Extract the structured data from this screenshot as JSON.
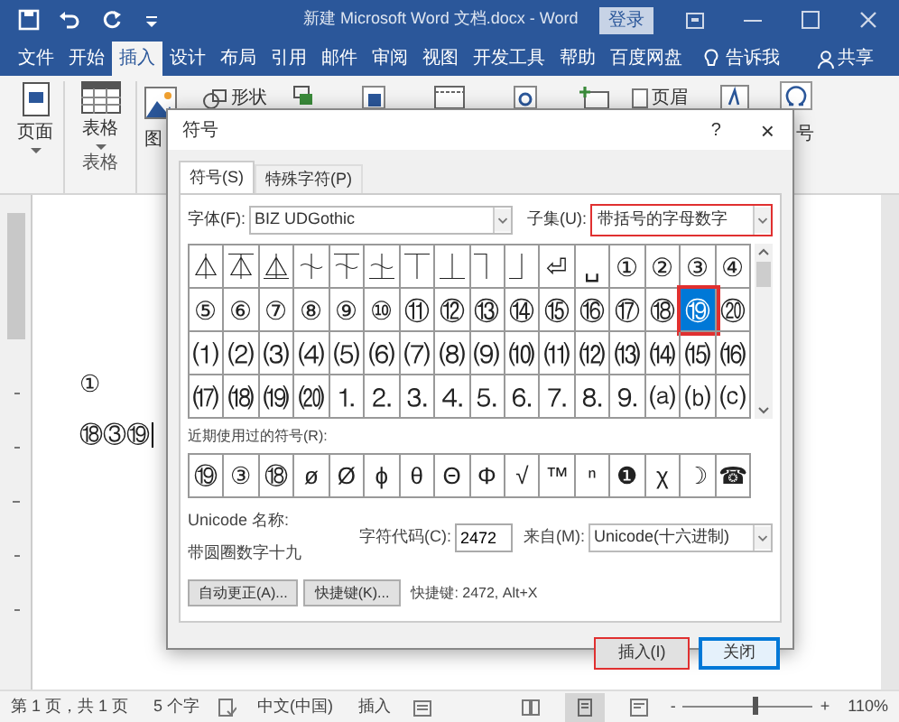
{
  "title_bar": {
    "title": "新建 Microsoft Word 文档.docx - Word",
    "login": "登录"
  },
  "menu_tabs": [
    {
      "label": "文件",
      "selected": false
    },
    {
      "label": "开始",
      "selected": false
    },
    {
      "label": "插入",
      "selected": true
    },
    {
      "label": "设计",
      "selected": false
    },
    {
      "label": "布局",
      "selected": false
    },
    {
      "label": "引用",
      "selected": false
    },
    {
      "label": "邮件",
      "selected": false
    },
    {
      "label": "审阅",
      "selected": false
    },
    {
      "label": "视图",
      "selected": false
    },
    {
      "label": "开发工具",
      "selected": false
    },
    {
      "label": "帮助",
      "selected": false
    },
    {
      "label": "百度网盘",
      "selected": false
    }
  ],
  "tell_me": "告诉我",
  "share": "共享",
  "ribbon": {
    "page_button": "页面",
    "table_button": "表格",
    "table_group": "表格",
    "picture_button": "图",
    "shapes_button": "形状",
    "header_button": "页眉",
    "symbol_button": "号"
  },
  "document": {
    "lines": [
      "①",
      "⑱③⑲"
    ]
  },
  "dialog": {
    "title": "符号",
    "help": "?",
    "close": "×",
    "tabs": [
      {
        "label": "符号(S)",
        "selected": true
      },
      {
        "label": "特殊字符(P)",
        "selected": false
      }
    ],
    "font_label": "字体(F):",
    "font": "BIZ UDGothic",
    "subset_label": "子集(U):",
    "subset": {
      "value": "带括号的字母数字",
      "highlighted": true
    },
    "symbol_rows": [
      [
        {
          "char": "⏃",
          "selected": false
        },
        {
          "char": "⏄",
          "selected": false
        },
        {
          "char": "⏅",
          "selected": false
        },
        {
          "char": "⏆",
          "selected": false
        },
        {
          "char": "⏇",
          "selected": false
        },
        {
          "char": "⏈",
          "selected": false
        },
        {
          "char": "⏉",
          "selected": false
        },
        {
          "char": "⏊",
          "selected": false
        },
        {
          "char": "⏋",
          "selected": false
        },
        {
          "char": "⏌",
          "selected": false
        },
        {
          "char": "⏎",
          "selected": false
        },
        {
          "char": "␣",
          "selected": false
        },
        {
          "char": "①",
          "selected": false
        },
        {
          "char": "②",
          "selected": false
        },
        {
          "char": "③",
          "selected": false
        },
        {
          "char": "④",
          "selected": false
        }
      ],
      [
        {
          "char": "⑤",
          "selected": false
        },
        {
          "char": "⑥",
          "selected": false
        },
        {
          "char": "⑦",
          "selected": false
        },
        {
          "char": "⑧",
          "selected": false
        },
        {
          "char": "⑨",
          "selected": false
        },
        {
          "char": "⑩",
          "selected": false
        },
        {
          "char": "⑪",
          "selected": false
        },
        {
          "char": "⑫",
          "selected": false
        },
        {
          "char": "⑬",
          "selected": false
        },
        {
          "char": "⑭",
          "selected": false
        },
        {
          "char": "⑮",
          "selected": false
        },
        {
          "char": "⑯",
          "selected": false
        },
        {
          "char": "⑰",
          "selected": false
        },
        {
          "char": "⑱",
          "selected": false
        },
        {
          "char": "⑲",
          "selected": true
        },
        {
          "char": "⑳",
          "selected": false
        }
      ],
      [
        {
          "char": "⑴",
          "selected": false
        },
        {
          "char": "⑵",
          "selected": false
        },
        {
          "char": "⑶",
          "selected": false
        },
        {
          "char": "⑷",
          "selected": false
        },
        {
          "char": "⑸",
          "selected": false
        },
        {
          "char": "⑹",
          "selected": false
        },
        {
          "char": "⑺",
          "selected": false
        },
        {
          "char": "⑻",
          "selected": false
        },
        {
          "char": "⑼",
          "selected": false
        },
        {
          "char": "⑽",
          "selected": false
        },
        {
          "char": "⑾",
          "selected": false
        },
        {
          "char": "⑿",
          "selected": false
        },
        {
          "char": "⒀",
          "selected": false
        },
        {
          "char": "⒁",
          "selected": false
        },
        {
          "char": "⒂",
          "selected": false
        },
        {
          "char": "⒃",
          "selected": false
        }
      ],
      [
        {
          "char": "⒄",
          "selected": false
        },
        {
          "char": "⒅",
          "selected": false
        },
        {
          "char": "⒆",
          "selected": false
        },
        {
          "char": "⒇",
          "selected": false
        },
        {
          "char": "⒈",
          "selected": false
        },
        {
          "char": "⒉",
          "selected": false
        },
        {
          "char": "⒊",
          "selected": false
        },
        {
          "char": "⒋",
          "selected": false
        },
        {
          "char": "⒌",
          "selected": false
        },
        {
          "char": "⒍",
          "selected": false
        },
        {
          "char": "⒎",
          "selected": false
        },
        {
          "char": "⒏",
          "selected": false
        },
        {
          "char": "⒐",
          "selected": false
        },
        {
          "char": "⒜",
          "selected": false
        },
        {
          "char": "⒝",
          "selected": false
        },
        {
          "char": "⒞",
          "selected": false
        }
      ]
    ],
    "recent_label": "近期使用过的符号(R):",
    "recent": [
      "⑲",
      "③",
      "⑱",
      "ø",
      "Ø",
      "ϕ",
      "θ",
      "Θ",
      "Φ",
      "√",
      "™",
      "ⁿ",
      "❶",
      "χ",
      "☽",
      "☎"
    ],
    "unicode_name_label": "Unicode 名称:",
    "unicode_name": "带圆圈数字十九",
    "char_code_label": "字符代码(C):",
    "char_code": "2472",
    "from_label": "来自(M):",
    "from": "Unicode(十六进制)",
    "autocorrect_button": "自动更正(A)...",
    "shortcut_button": "快捷键(K)...",
    "shortcut_info": "快捷键: 2472, Alt+X",
    "insert_button": {
      "label": "插入(I)",
      "highlighted": true
    },
    "close_button": "关闭"
  },
  "status_bar": {
    "page": "第 1 页，共 1 页",
    "words": "5 个字",
    "language": "中文(中国)",
    "mode": "插入",
    "zoom_out": "-",
    "zoom_in": "+",
    "zoom": {
      "level": 0.55
    },
    "zoom_text": "110%"
  }
}
